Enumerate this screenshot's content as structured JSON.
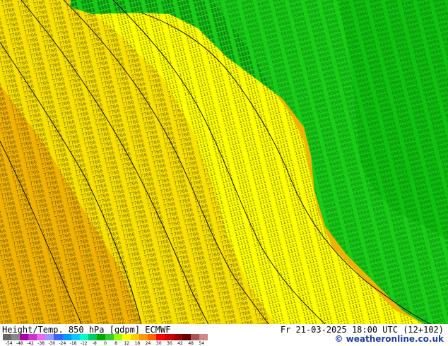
{
  "map": {
    "colors": {
      "ocean_green_dark": "#10c010",
      "ocean_green": "#18cc18",
      "green_light": "#30d830",
      "yellow": "#ffff00",
      "yellow_orange": "#f8e000",
      "orange": "#f0b400",
      "orange_dark": "#e89c00",
      "contour": "#000000"
    }
  },
  "footer": {
    "title_left": "Height/Temp. 850 hPa [gdpm] ECMWF",
    "title_right": "Fr 21-03-2025 18:00 UTC (12+102)",
    "credit": "© weatheronline.co.uk",
    "scale_colors": [
      "#666666",
      "#888888",
      "#aa00aa",
      "#cc33cc",
      "#ee66ee",
      "#9999ff",
      "#3366ff",
      "#0099ff",
      "#00ccff",
      "#00ffcc",
      "#00cc66",
      "#00aa00",
      "#33cc33",
      "#99ff00",
      "#ffff00",
      "#ffcc00",
      "#ff9900",
      "#ff6600",
      "#ff0000",
      "#cc0000",
      "#990000",
      "#660000",
      "#aa5555",
      "#cc8888"
    ],
    "scale_labels": [
      "-54",
      "-48",
      "-42",
      "-38",
      "-30",
      "-24",
      "-18",
      "-12",
      "-8",
      "0",
      "8",
      "12",
      "18",
      "24",
      "30",
      "36",
      "42",
      "48",
      "54"
    ]
  }
}
